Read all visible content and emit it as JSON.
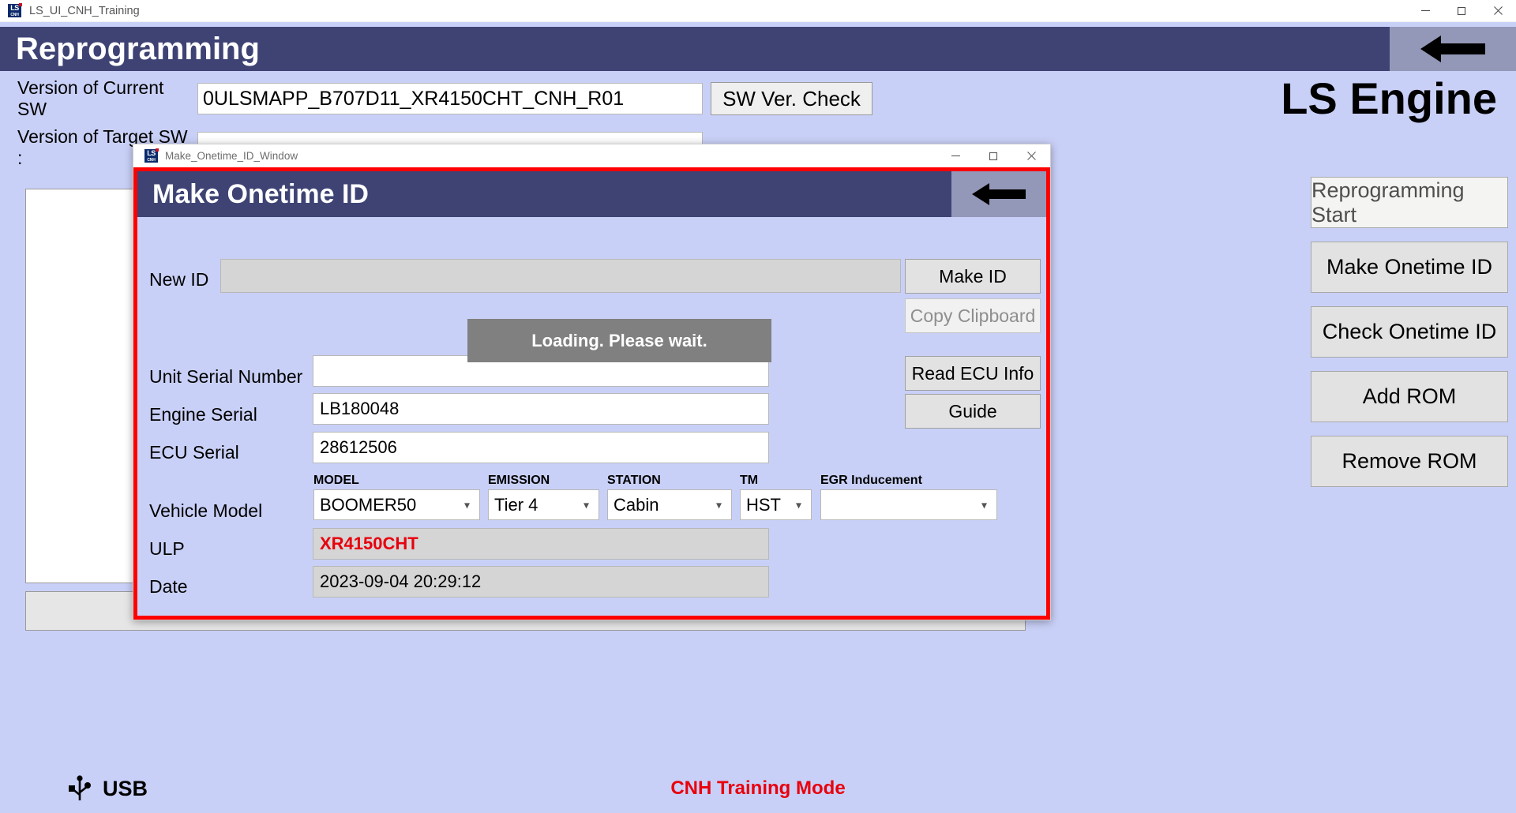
{
  "os_window": {
    "title": "LS_UI_CNH_Training",
    "logo_top": "LS",
    "logo_bottom": "CNH",
    "controls": {
      "minimize": "minimize-icon",
      "maximize": "maximize-icon",
      "close": "close-icon"
    }
  },
  "banner": {
    "title": "Reprogramming",
    "back_icon": "arrow-left-icon"
  },
  "version_section": {
    "current_label": "Version of Current SW",
    "current_value": "0ULSMAPP_B707D11_XR4150CHT_CNH_R01",
    "target_label": "Version of Target SW :",
    "target_value": "",
    "sw_check_button": "SW Ver. Check"
  },
  "brand": {
    "engine_label": "LS Engine"
  },
  "sidebar": {
    "items": [
      {
        "label": "Reprogramming Start",
        "name": "reprogramming-start-button",
        "style": "primary"
      },
      {
        "label": "Make Onetime ID",
        "name": "make-onetime-id-button",
        "style": "normal"
      },
      {
        "label": "Check Onetime ID",
        "name": "check-onetime-id-button",
        "style": "normal"
      },
      {
        "label": "Add ROM",
        "name": "add-rom-button",
        "style": "normal"
      },
      {
        "label": "Remove ROM",
        "name": "remove-rom-button",
        "style": "normal"
      }
    ]
  },
  "statusbar": {
    "usb_label": "USB",
    "usb_icon": "usb-icon",
    "training_mode": "CNH Training Mode",
    "training_mode_color": "#e8000d"
  },
  "dialog": {
    "window_title": "Make_Onetime_ID_Window",
    "banner_title": "Make Onetime ID",
    "back_icon": "arrow-left-icon",
    "controls": {
      "minimize": "minimize-icon",
      "maximize": "maximize-icon",
      "close": "close-icon"
    },
    "highlight_border_color": "#ff0000",
    "loading_message": "Loading.  Please wait.",
    "fields": {
      "new_id_label": "New ID",
      "new_id_value": "",
      "unit_serial_label": "Unit Serial Number",
      "unit_serial_value": "",
      "engine_serial_label": "Engine Serial",
      "engine_serial_value": "LB180048",
      "ecu_serial_label": "ECU Serial",
      "ecu_serial_value": "28612506",
      "vehicle_model_label": "Vehicle Model",
      "ulp_label": "ULP",
      "ulp_value": "XR4150CHT",
      "date_label": "Date",
      "date_value": "2023-09-04 20:29:12"
    },
    "combos": [
      {
        "label": "MODEL",
        "value": "BOOMER50",
        "name": "model-select"
      },
      {
        "label": "EMISSION",
        "value": "Tier 4",
        "name": "emission-select"
      },
      {
        "label": "STATION",
        "value": "Cabin",
        "name": "station-select"
      },
      {
        "label": "TM",
        "value": "HST",
        "name": "tm-select"
      },
      {
        "label": "EGR Inducement",
        "value": "",
        "name": "egr-inducement-select"
      }
    ],
    "buttons": {
      "make_id": "Make ID",
      "copy_clipboard": "Copy Clipboard",
      "read_ecu_info": "Read ECU Info",
      "guide": "Guide"
    }
  }
}
